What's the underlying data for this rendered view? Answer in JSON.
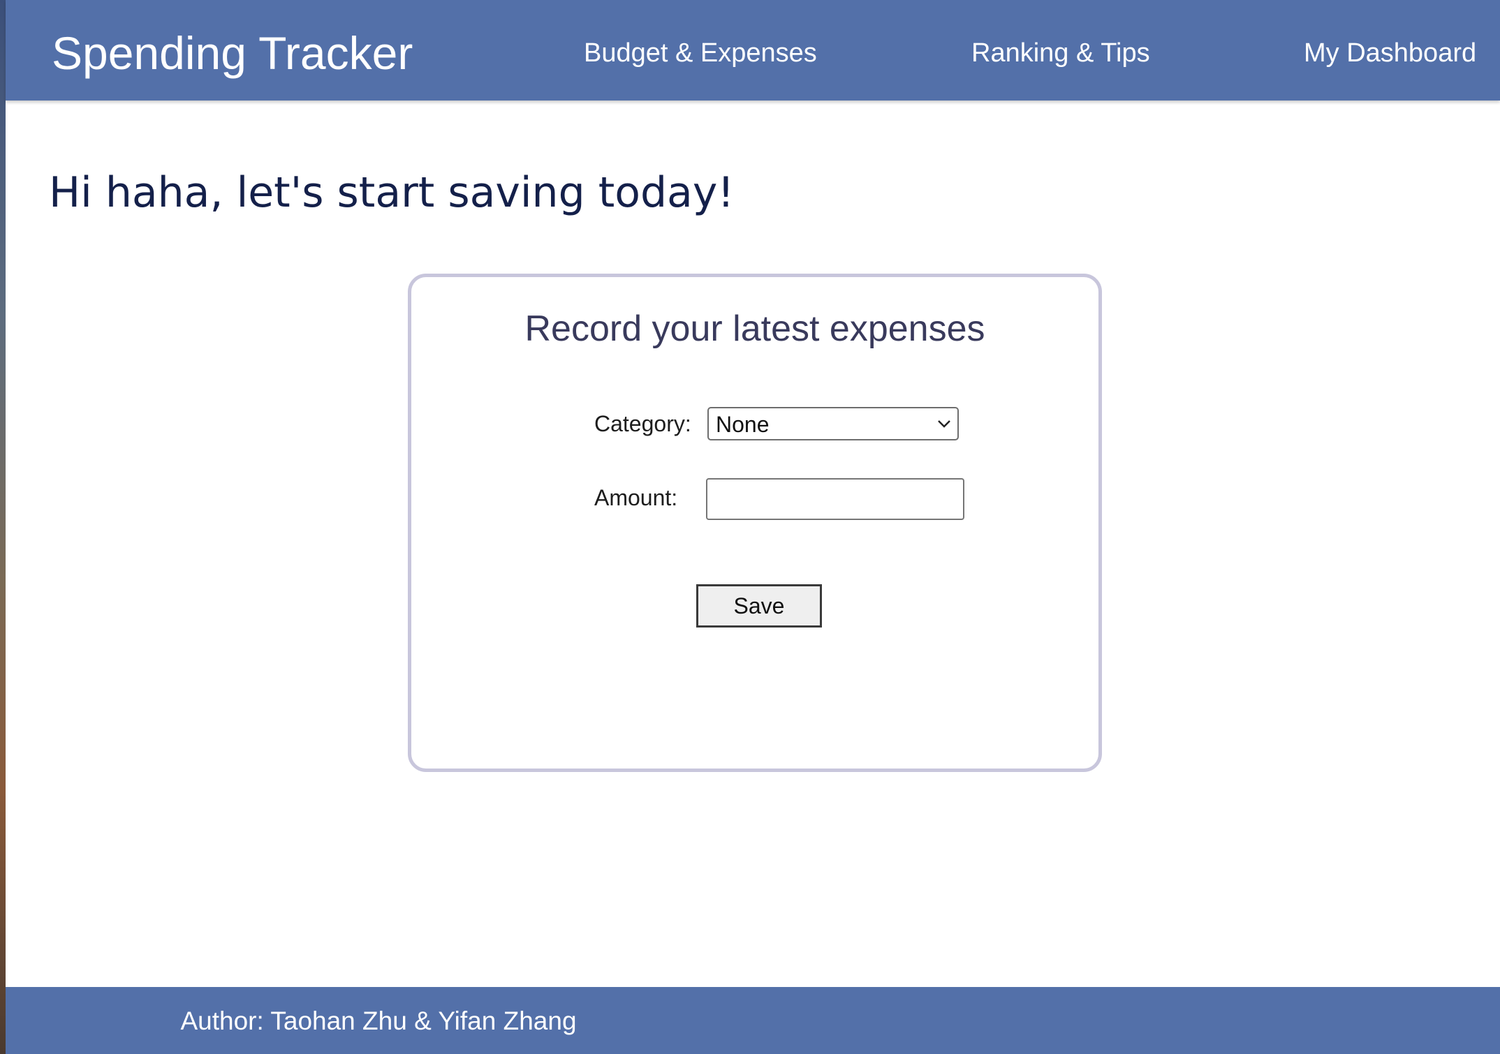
{
  "header": {
    "brand": "Spending Tracker",
    "nav": [
      {
        "label": "Budget & Expenses"
      },
      {
        "label": "Ranking & Tips"
      },
      {
        "label": "My Dashboard"
      }
    ]
  },
  "main": {
    "greeting": "Hi haha, let's start saving today!"
  },
  "expense_form": {
    "title": "Record your latest expenses",
    "category_label": "Category:",
    "category_selected": "None",
    "amount_label": "Amount:",
    "amount_value": "",
    "save_label": "Save"
  },
  "footer": {
    "text": "Author: Taohan Zhu & Yifan Zhang"
  },
  "colors": {
    "navbar": "#5370a9",
    "greeting_text": "#14204a",
    "card_border": "#c8c6dc",
    "card_title": "#393a5c"
  },
  "icons": {
    "select_chevron": "chevron-down-icon"
  }
}
